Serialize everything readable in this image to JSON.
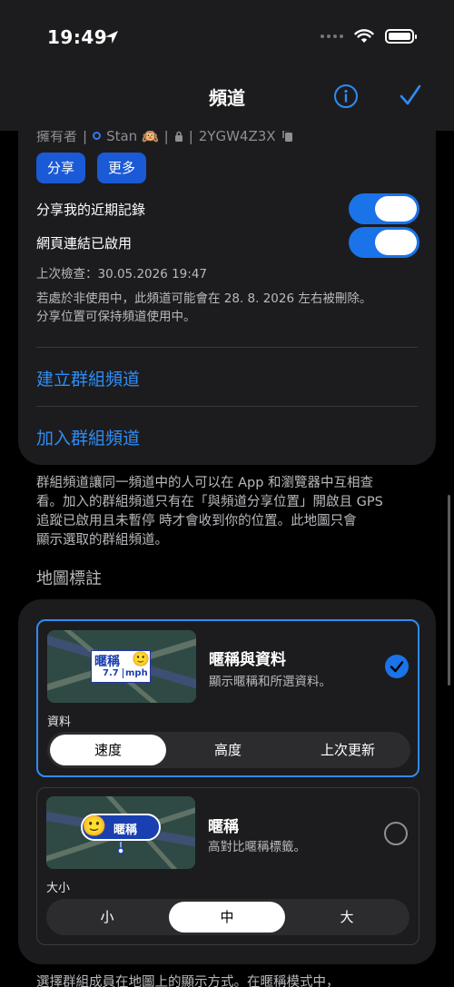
{
  "status_bar": {
    "time": "19:49"
  },
  "nav": {
    "title": "頻道"
  },
  "channel": {
    "owner_label": "擁有者",
    "separator": "|",
    "owner_name": "Stan 🙉",
    "channel_code": "2YGW4Z3X",
    "share_button": "分享",
    "more_button": "更多",
    "share_recent_label": "分享我的近期記錄",
    "share_recent_on": true,
    "web_link_label": "網頁連結已啟用",
    "web_link_on": true,
    "last_check": "上次檢查：30.05.2026 19:47",
    "deletion_note_1": "若處於非使用中，此頻道可能會在 28. 8. 2026 左右被刪除。",
    "deletion_note_2": "分享位置可保持頻道使用中。",
    "create_group": "建立群組頻道",
    "join_group": "加入群組頻道"
  },
  "group_footnote": [
    "群組頻道讓同一頻道中的人可以在 App 和瀏覽器中互相查",
    "看。加入的群組頻道只有在「與頻道分享位置」開啟且 GPS",
    "追蹤已啟用且未暫停 時才會收到你的位置。此地圖只會",
    "顯示選取的群組頻道。"
  ],
  "map_labels": {
    "section_title": "地圖標註",
    "options": [
      {
        "title": "暱稱與資料",
        "description": "顯示暱稱和所選資料。",
        "selected": true,
        "preview_name": "暱稱",
        "preview_value": "7.7",
        "preview_unit": "mph",
        "segment_label": "資料",
        "segments": [
          "速度",
          "高度",
          "上次更新"
        ],
        "active_segment": "速度"
      },
      {
        "title": "暱稱",
        "description": "高對比暱稱標籤。",
        "selected": false,
        "preview_name": "暱稱",
        "segment_label": "大小",
        "segments": [
          "小",
          "中",
          "大"
        ],
        "active_segment": "中"
      }
    ]
  },
  "bottom_footnote": "選擇群組成員在地圖上的顯示方式。在暱稱模式中，",
  "colors": {
    "accent": "#2f8cf4",
    "toggle": "#1a73e8",
    "card": "#1c1c1e",
    "background": "#000000"
  }
}
